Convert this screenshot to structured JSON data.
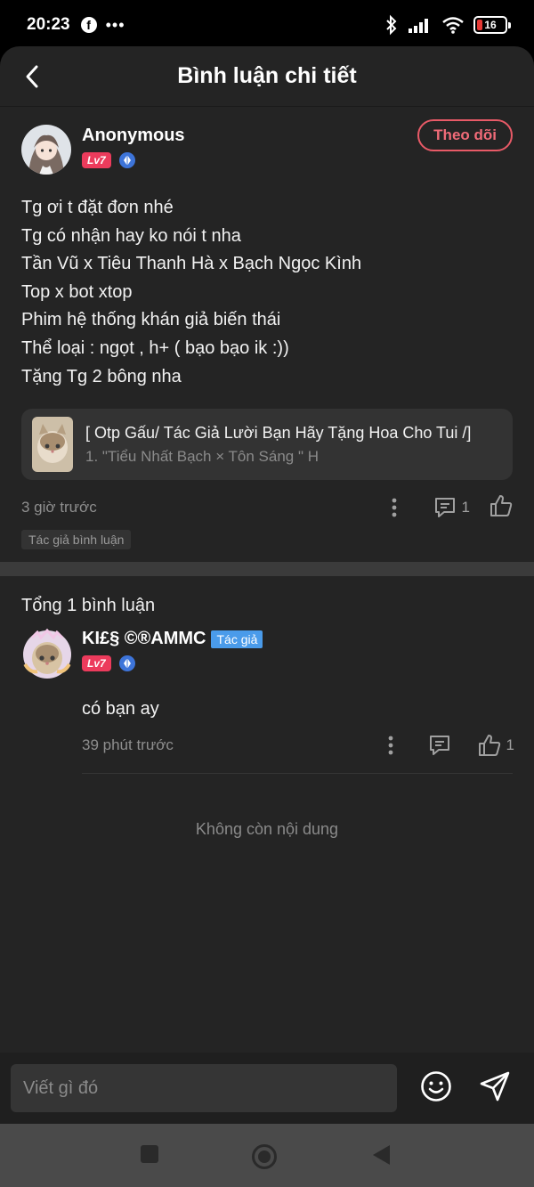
{
  "status": {
    "time": "20:23",
    "battery": "16"
  },
  "header": {
    "title": "Bình luận chi tiết"
  },
  "post": {
    "author": "Anonymous",
    "level": "Lv7",
    "follow_label": "Theo dõi",
    "lines": [
      "Tg ơi t đặt đơn nhé",
      "Tg có nhận hay ko nói t nha",
      "Tần Vũ x Tiêu Thanh Hà x Bạch Ngọc Kình",
      "Top x bot xtop",
      "Phim hệ thống khán giả biến thái",
      "Thể loại : ngọt , h+ ( bạo bạo ik :))",
      "Tặng Tg 2 bông nha"
    ],
    "book": {
      "title": "[ Otp Gấu/ Tác Giả Lười Bạn Hãy Tặng Hoa Cho Tui /]",
      "chapter": "1. \"Tiểu Nhất Bạch × Tôn Sáng \" H"
    },
    "time": "3 giờ trước",
    "comment_count": "1",
    "author_tag": "Tác giả bình luận"
  },
  "comments": {
    "total_label": "Tổng 1 bình luận",
    "items": [
      {
        "name": "KI£§ ©®AMMC",
        "author_badge": "Tác giả",
        "level": "Lv7",
        "text": "có bạn ay",
        "time": "39 phút trước",
        "likes": "1"
      }
    ],
    "end_label": "Không còn nội dung"
  },
  "composer": {
    "placeholder": "Viết gì đó"
  },
  "icons": {
    "back": "chevron-left-icon",
    "gem": "diamond-badge-icon",
    "more": "vertical-dots-icon",
    "comment": "comment-icon",
    "like": "thumbs-up-icon",
    "emoji": "smile-icon",
    "send": "send-icon"
  },
  "colors": {
    "accent_red": "#ec3b5c",
    "follow": "#f06b78",
    "author_badge": "#4a9bea",
    "background": "#242424"
  }
}
